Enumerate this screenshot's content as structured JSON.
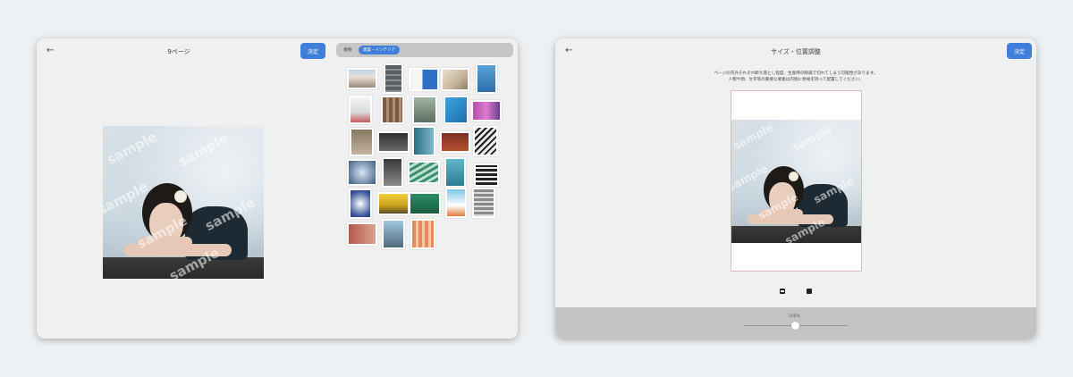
{
  "left_screen": {
    "header": {
      "title": "9ページ",
      "confirm_label": "決定"
    },
    "tabs": [
      {
        "label": "動物",
        "active": false
      },
      {
        "label": "建築・インテリア",
        "active": true
      }
    ],
    "watermark": "sample"
  },
  "right_screen": {
    "header": {
      "title": "サイズ・位置調整",
      "confirm_label": "決定"
    },
    "notice_lines": [
      "ページの内外それぞれ断ち落とし程度、生産時の断裁で切れてしまう可能性があります。",
      "人物や顔、文字等の重要な要素は内側に余裕を持って配置してください。"
    ],
    "watermark": "sample",
    "zoom": {
      "label": "100%",
      "value_percent": 100
    }
  },
  "colors": {
    "accent": "#3f7fd9",
    "canvas_border": "#e6b6bd"
  },
  "icons": [
    "back-arrow-icon",
    "fit-image-icon",
    "fill-image-icon"
  ]
}
